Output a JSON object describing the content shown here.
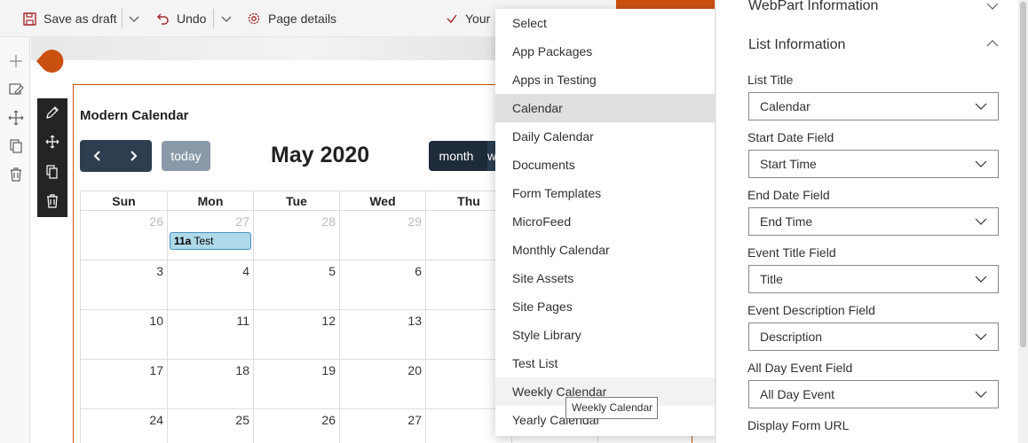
{
  "toolbar": {
    "save_draft": "Save as draft",
    "undo": "Undo",
    "page_details": "Page details",
    "your_partial": "Your"
  },
  "webpart": {
    "title": "Modern Calendar",
    "today": "today",
    "month_title": "May 2020",
    "view_month": "month",
    "view_week_partial": "w"
  },
  "calendar": {
    "day_headers": [
      "Sun",
      "Mon",
      "Tue",
      "Wed",
      "Thu"
    ],
    "weeks": [
      [
        "26",
        "27",
        "28",
        "29",
        ""
      ],
      [
        "3",
        "4",
        "5",
        "6",
        ""
      ],
      [
        "10",
        "11",
        "12",
        "13",
        ""
      ],
      [
        "17",
        "18",
        "19",
        "20",
        ""
      ],
      [
        "24",
        "25",
        "26",
        "27",
        ""
      ]
    ],
    "event": {
      "time": "11a",
      "title": "Test"
    }
  },
  "dropdown": {
    "options": [
      "Select",
      "App Packages",
      "Apps in Testing",
      "Calendar",
      "Daily Calendar",
      "Documents",
      "Form Templates",
      "MicroFeed",
      "Monthly Calendar",
      "Site Assets",
      "Site Pages",
      "Style Library",
      "Test List",
      "Weekly Calendar",
      "Yearly Calendar"
    ],
    "selected": "Calendar",
    "hovered": "Weekly Calendar",
    "tooltip": "Weekly Calendar"
  },
  "pane": {
    "section_webpart": "WebPart Information",
    "section_list": "List Information",
    "fields": [
      {
        "label": "List Title",
        "value": "Calendar"
      },
      {
        "label": "Start Date Field",
        "value": "Start Time"
      },
      {
        "label": "End Date Field",
        "value": "End Time"
      },
      {
        "label": "Event Title Field",
        "value": "Title"
      },
      {
        "label": "Event Description Field",
        "value": "Description"
      },
      {
        "label": "All Day Event Field",
        "value": "All Day Event"
      }
    ],
    "last_label": "Display Form URL"
  },
  "colors": {
    "accent": "#ca5010",
    "nav_dark": "#2c3e50",
    "event_bg": "#aed9e8",
    "today_btn": "#8a9aa8"
  }
}
